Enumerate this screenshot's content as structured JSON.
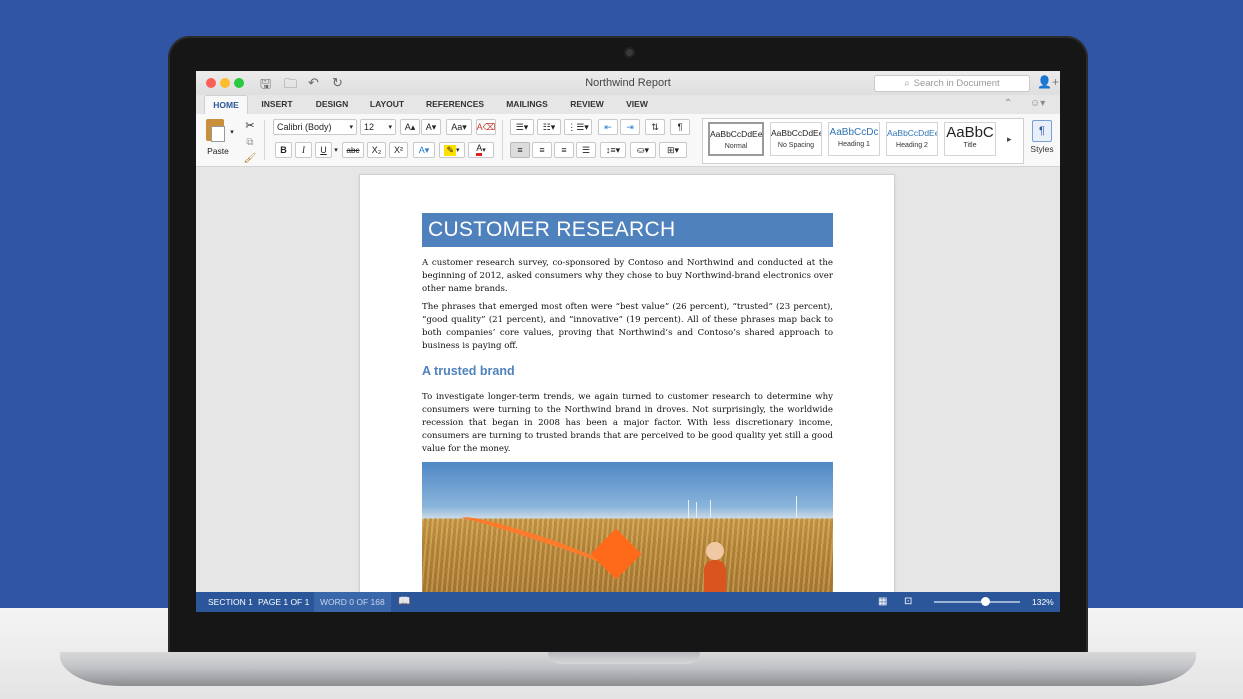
{
  "window": {
    "title": "Northwind Report",
    "search_placeholder": "Search in Document"
  },
  "tabs": [
    {
      "label": "HOME",
      "active": true
    },
    {
      "label": "INSERT"
    },
    {
      "label": "DESIGN"
    },
    {
      "label": "LAYOUT"
    },
    {
      "label": "REFERENCES"
    },
    {
      "label": "MAILINGS"
    },
    {
      "label": "REVIEW"
    },
    {
      "label": "VIEW"
    }
  ],
  "ribbon": {
    "paste_label": "Paste",
    "font_name": "Calibri (Body)",
    "font_size": "12",
    "bold": "B",
    "italic": "I",
    "underline": "U",
    "strikethrough": "abc",
    "subscript": "X₂",
    "superscript": "X²",
    "pilcrow": "¶",
    "styles_label": "Styles",
    "styles": [
      {
        "sample": "AaBbCcDdEe",
        "name": "Normal",
        "selected": true
      },
      {
        "sample": "AaBbCcDdEe",
        "name": "No Spacing"
      },
      {
        "sample": "AaBbCcDc",
        "name": "Heading 1"
      },
      {
        "sample": "AaBbCcDdEe",
        "name": "Heading 2"
      },
      {
        "sample": "AaBbC",
        "name": "Title"
      }
    ]
  },
  "document": {
    "heading": "CUSTOMER RESEARCH",
    "para1": "A customer research survey, co-sponsored by Contoso and Northwind and conducted at the beginning of 2012, asked consumers why they chose to buy Northwind-brand electronics over other name brands.",
    "para2": "The phrases that emerged most often were “best value” (26 percent), “trusted” (23 percent), “good quality” (21 percent), and “innovative” (19 percent). All of these phrases map back to both companies’ core values, proving that Northwind’s and Contoso’s shared approach to business is paying off.",
    "subheading": "A trusted brand",
    "para3": "To investigate longer-term trends, we again turned to customer research to determine why consumers were turning to the Northwind brand in droves. Not surprisingly, the worldwide recession that began in 2008 has been a major factor. With less discretionary income, consumers are turning to trusted brands that are perceived to be good quality yet still a good value for the money."
  },
  "status": {
    "section": "SECTION 1",
    "page": "PAGE 1 OF 1",
    "words": "WORD 0 OF 168",
    "zoom": "132%"
  },
  "colors": {
    "accent": "#2b579a",
    "heading_fill": "#4f81bd",
    "background": "#2f55a4"
  }
}
